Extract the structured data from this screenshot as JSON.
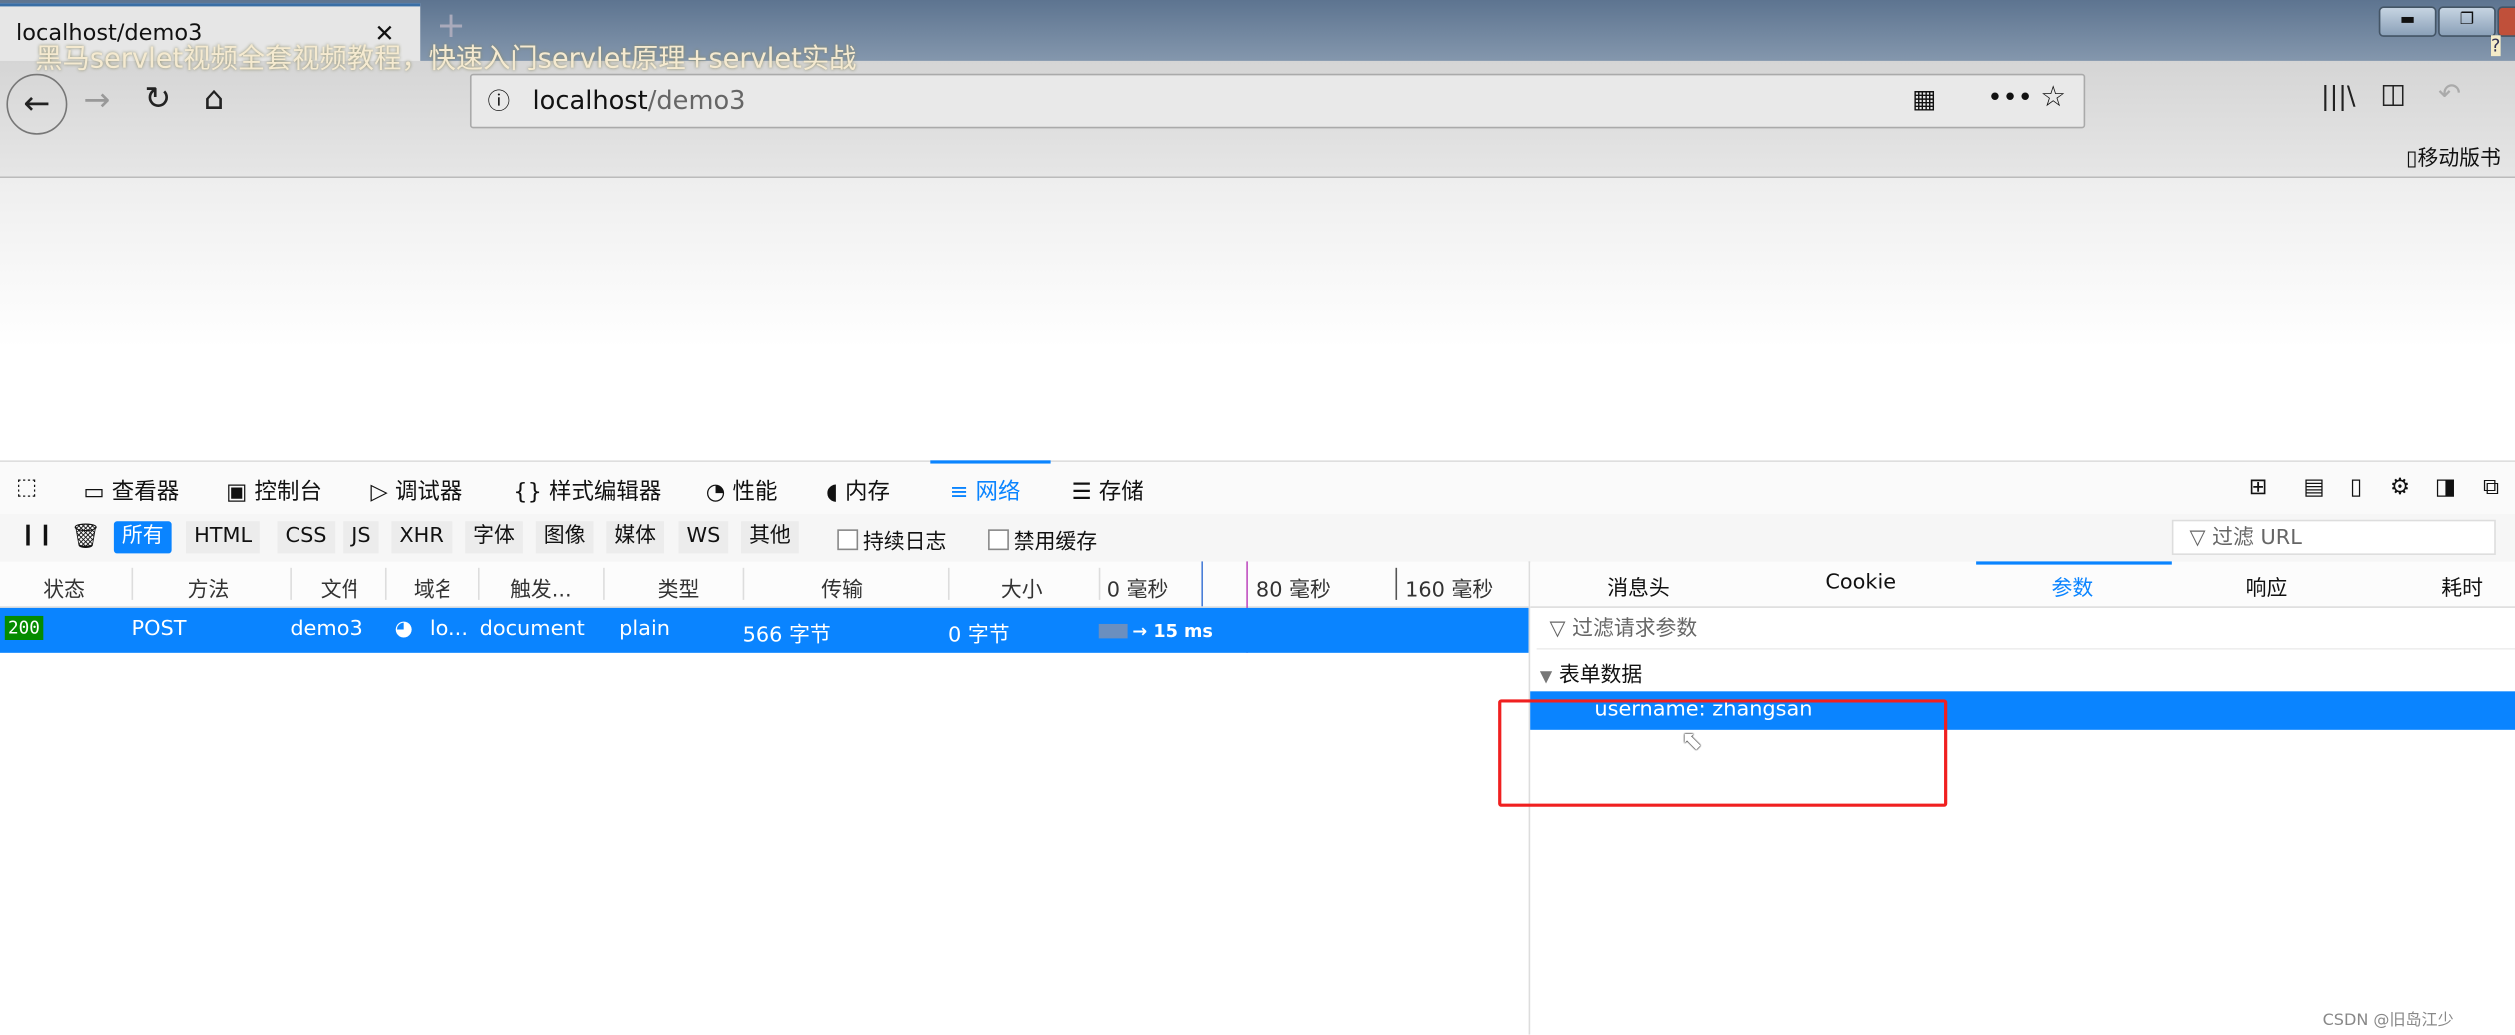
{
  "window": {
    "tab_title": "localhost/demo3",
    "watermark": "黑马servlet视频全套视频教程，快速入门servlet原理+servlet实战",
    "help": "?"
  },
  "nav": {
    "url_host": "localhost",
    "url_path": "/demo3",
    "bookmark": "移动版书"
  },
  "devtools": {
    "tabs": [
      {
        "label": "查看器"
      },
      {
        "label": "控制台"
      },
      {
        "label": "调试器"
      },
      {
        "label": "样式编辑器"
      },
      {
        "label": "性能"
      },
      {
        "label": "内存"
      },
      {
        "label": "网络"
      },
      {
        "label": "存储"
      }
    ],
    "active_tab": "网络",
    "filters": [
      "所有",
      "HTML",
      "CSS",
      "JS",
      "XHR",
      "字体",
      "图像",
      "媒体",
      "WS",
      "其他"
    ],
    "active_filter": "所有",
    "checkboxes": [
      {
        "label": "持续日志",
        "checked": false
      },
      {
        "label": "禁用缓存",
        "checked": false
      }
    ],
    "url_filter_placeholder": "过滤 URL",
    "columns": [
      "状态",
      "方法",
      "文件",
      "域名",
      "触发...",
      "类型",
      "传输",
      "大小",
      "0 毫秒",
      "80 毫秒",
      "160 毫秒"
    ],
    "request": {
      "status": "200",
      "method": "POST",
      "file": "demo3",
      "domain": "lo...",
      "cause": "document",
      "type": "plain",
      "transferred": "566 字节",
      "size": "0 字节",
      "timing": "→ 15 ms"
    },
    "detail_tabs": [
      "消息头",
      "Cookie",
      "参数",
      "响应",
      "耗时"
    ],
    "active_detail_tab": "参数",
    "param_filter_placeholder": "过滤请求参数",
    "form_data_title": "表单数据",
    "form_data": "username: zhangsan"
  },
  "footer": {
    "credit": "CSDN @旧岛江少"
  },
  "colors": {
    "accent": "#0a84ff",
    "status_ok": "#058b00",
    "highlight_box": "#f02020"
  }
}
